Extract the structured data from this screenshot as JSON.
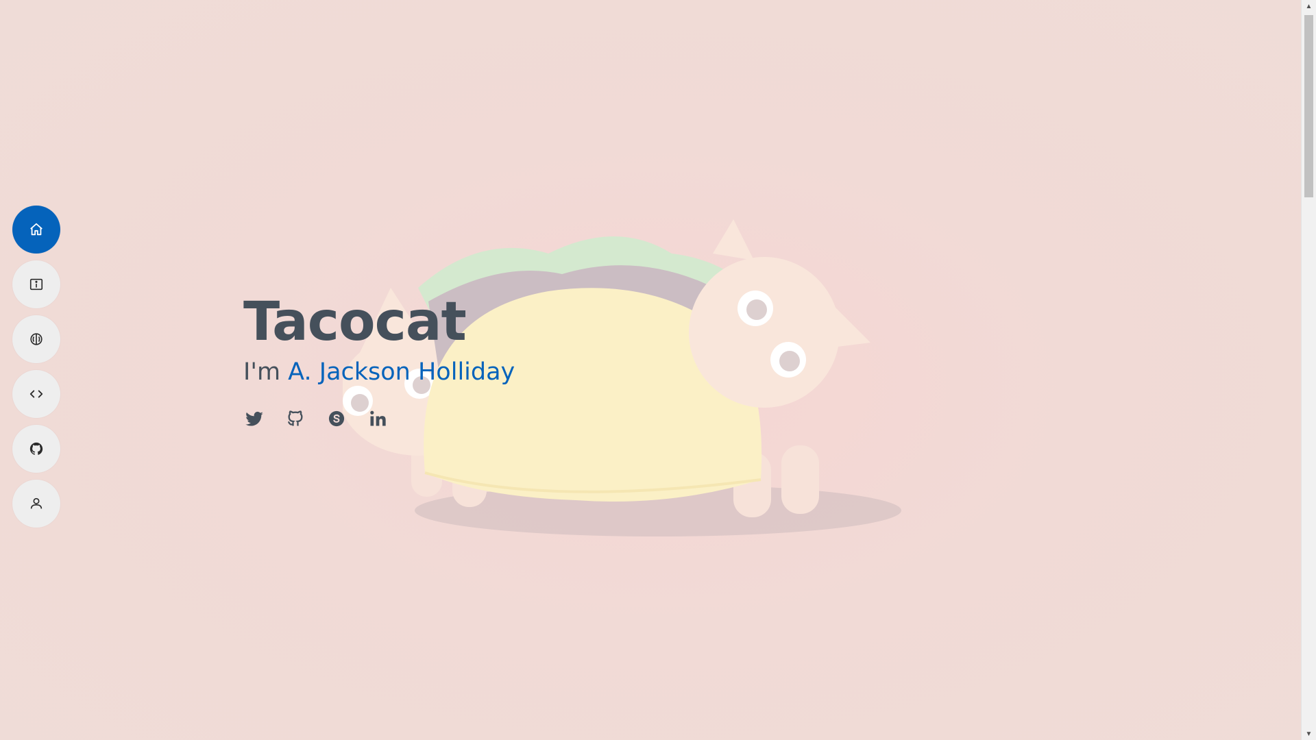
{
  "hero": {
    "title": "Tacocat",
    "subtitle_prefix": "I'm ",
    "subtitle_name": "A. Jackson Holliday"
  },
  "nav": {
    "items": [
      {
        "icon": "home-icon",
        "active": true
      },
      {
        "icon": "info-icon",
        "active": false
      },
      {
        "icon": "brain-icon",
        "active": false
      },
      {
        "icon": "code-icon",
        "active": false
      },
      {
        "icon": "github-icon",
        "active": false
      },
      {
        "icon": "person-icon",
        "active": false
      }
    ]
  },
  "social": [
    {
      "icon": "twitter-icon"
    },
    {
      "icon": "github-icon"
    },
    {
      "icon": "skype-icon"
    },
    {
      "icon": "linkedin-icon"
    }
  ],
  "colors": {
    "accent": "#0563bb",
    "text": "#45505b",
    "background": "#f1dad6"
  }
}
